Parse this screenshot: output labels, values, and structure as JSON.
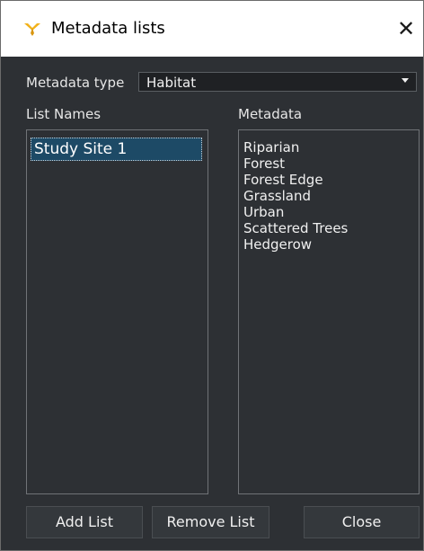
{
  "window": {
    "title": "Metadata lists",
    "close_glyph": "✕",
    "icon": "bird-logo-icon"
  },
  "metadata_type": {
    "label": "Metadata type",
    "selected": "Habitat"
  },
  "list_names": {
    "label": "List Names",
    "items": [
      "Study Site 1"
    ],
    "selected_index": 0
  },
  "metadata": {
    "label": "Metadata",
    "items": [
      "Riparian",
      "Forest",
      "Forest Edge",
      "Grassland",
      "Urban",
      "Scattered Trees",
      "Hedgerow"
    ]
  },
  "buttons": {
    "add": "Add List",
    "remove": "Remove List",
    "close": "Close"
  },
  "colors": {
    "background": "#2d3034",
    "selection": "#1d4a66",
    "logo": "#f2b21a"
  }
}
